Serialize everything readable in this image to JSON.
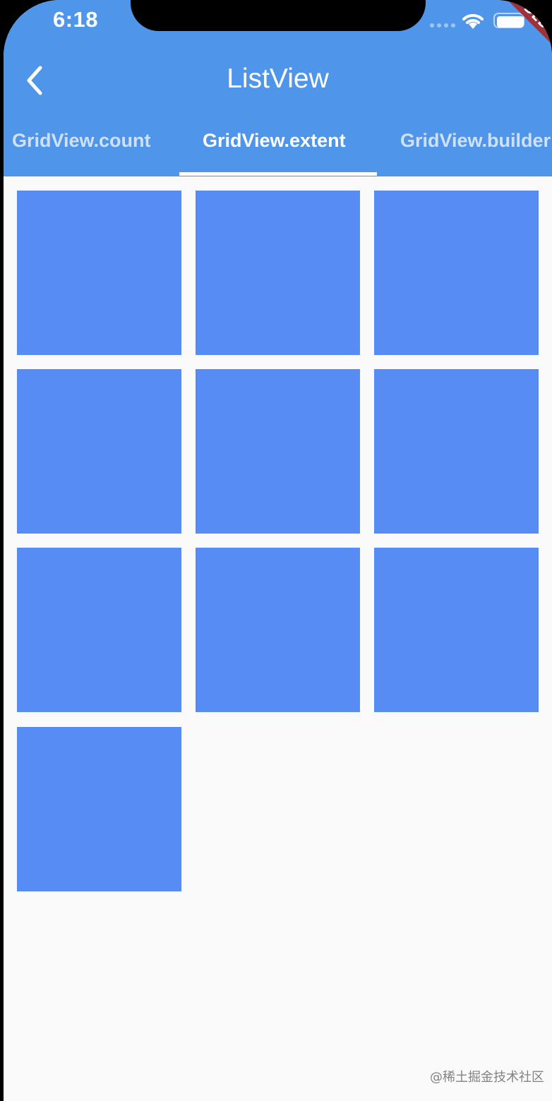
{
  "status_bar": {
    "time": "6:18",
    "debug_label": "DEBUG"
  },
  "app_bar": {
    "title": "ListView",
    "back_icon": "chevron-left-icon",
    "background_color": "#4f95ea"
  },
  "tabs": [
    {
      "label": "GridView.count",
      "selected": false
    },
    {
      "label": "GridView.extent",
      "selected": true
    },
    {
      "label": "GridView.builder",
      "selected": false
    }
  ],
  "grid": {
    "tile_color": "#578cf5",
    "tile_count": 10
  },
  "watermark": "@稀土掘金技术社区"
}
